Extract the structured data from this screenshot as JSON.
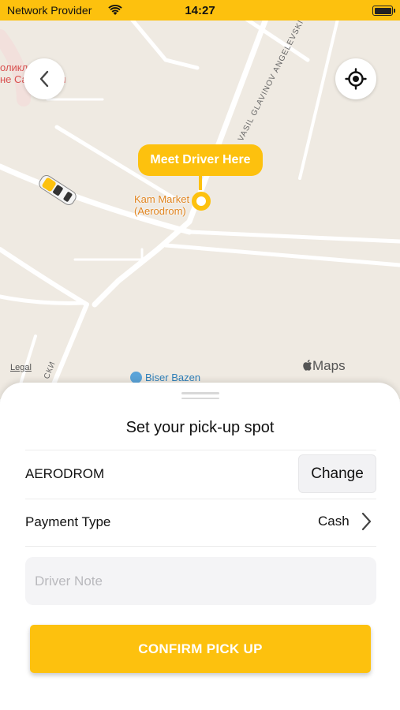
{
  "status_bar": {
    "carrier": "Network Provider",
    "time": "14:27"
  },
  "map": {
    "poi_cyrillic_line1": "оликл",
    "poi_cyrillic_line2": "не Сандански",
    "poi_name_line1": "Kam Market",
    "poi_name_line2": "(Aerodrom)",
    "street_name": "VASIL GLAVINOV ANGELEVSKI",
    "street_name_2": "СКИ",
    "biser_label": "Biser Bazen",
    "legal": "Legal",
    "maps_brand": "Maps",
    "callout": "Meet Driver Here"
  },
  "sheet": {
    "title": "Set your pick-up spot",
    "location": "AERODROM",
    "change_label": "Change",
    "payment_label": "Payment Type",
    "payment_value": "Cash",
    "note_placeholder": "Driver Note",
    "note_value": "",
    "confirm_label": "CONFIRM PICK UP"
  },
  "colors": {
    "accent": "#fdc10e",
    "map_background": "#efeae2",
    "poi_orange": "#e0841f",
    "poi_red": "#d9504f"
  },
  "icons": {
    "back": "chevron-left-icon",
    "locate": "crosshair-location-icon",
    "payment_chevron": "chevron-right-icon",
    "wifi": "wifi-icon",
    "battery": "battery-icon",
    "apple": "apple-logo-icon"
  }
}
